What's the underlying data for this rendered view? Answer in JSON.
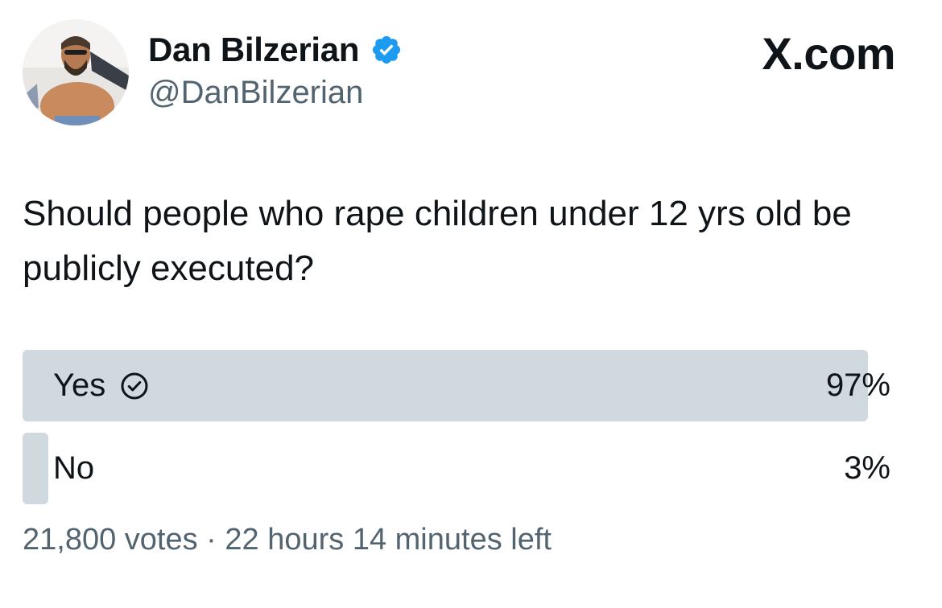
{
  "author": {
    "display_name": "Dan Bilzerian",
    "handle": "@DanBilzerian",
    "verified": true,
    "verified_color": "#1d9bf0"
  },
  "brand": "X.com",
  "tweet": {
    "text": "Should people who rape children under 12 yrs old be publicly executed?"
  },
  "poll": {
    "options": [
      {
        "label": "Yes",
        "percent_label": "97%",
        "percent": 97,
        "selected": true
      },
      {
        "label": "No",
        "percent_label": "3%",
        "percent": 3,
        "selected": false
      }
    ],
    "votes": "21,800 votes",
    "separator": " · ",
    "time_left": "22 hours 14 minutes left",
    "bar_color": "#cfd9de"
  },
  "colors": {
    "text_primary": "#0f1419",
    "text_secondary": "#536471"
  }
}
